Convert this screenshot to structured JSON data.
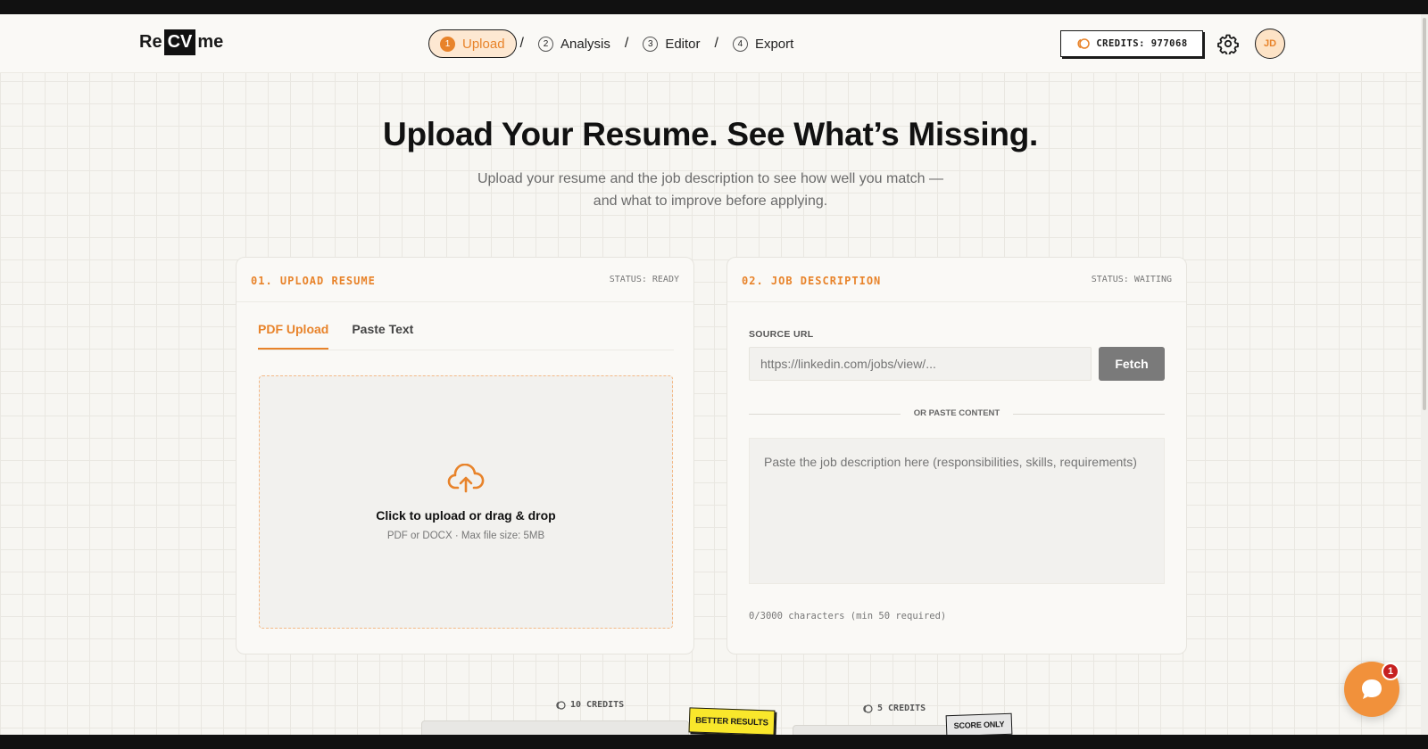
{
  "app": {
    "logo": {
      "left": "Re",
      "mid": "CV",
      "right": "me"
    }
  },
  "steps": [
    {
      "num": "1",
      "label": "Upload",
      "active": true
    },
    {
      "num": "2",
      "label": "Analysis",
      "active": false
    },
    {
      "num": "3",
      "label": "Editor",
      "active": false
    },
    {
      "num": "4",
      "label": "Export",
      "active": false
    }
  ],
  "step_separator": "/",
  "header": {
    "credits_label": "CREDITS: 977068",
    "avatar_initials": "JD",
    "icons": {
      "credits": "coin-icon",
      "settings": "gear-icon"
    }
  },
  "hero": {
    "title": "Upload Your Resume. See What’s Missing.",
    "subtitle": "Upload your resume and the job description to see how well you match — and what to improve before applying."
  },
  "upload_card": {
    "title": "01. UPLOAD RESUME",
    "status": "STATUS: READY",
    "tabs": [
      {
        "label": "PDF Upload",
        "active": true
      },
      {
        "label": "Paste Text",
        "active": false
      }
    ],
    "dropzone": {
      "icon": "cloud-upload-icon",
      "title": "Click to upload or drag & drop",
      "subtitle": "PDF or DOCX · Max file size: 5MB"
    }
  },
  "job_card": {
    "title": "02. JOB DESCRIPTION",
    "status": "STATUS: WAITING",
    "source_label": "SOURCE URL",
    "url_placeholder": "https://linkedin.com/jobs/view/...",
    "url_value": "",
    "fetch_label": "Fetch",
    "divider_label": "OR PASTE CONTENT",
    "textarea_placeholder": "Paste the job description here (responsibilities, skills, requirements)",
    "textarea_value": "",
    "char_count": "0/3000 characters (min 50 required)"
  },
  "options": [
    {
      "credits": "10 CREDITS",
      "badge": "BETTER RESULTS"
    },
    {
      "credits": "5 CREDITS",
      "badge": "SCORE ONLY"
    }
  ],
  "chat": {
    "icon": "chat-bubble-icon",
    "badge_count": "1"
  },
  "colors": {
    "accent": "#e8832a",
    "background": "#f7f6f2",
    "badge_yellow": "#f9e72b",
    "notification_red": "#c62020"
  }
}
